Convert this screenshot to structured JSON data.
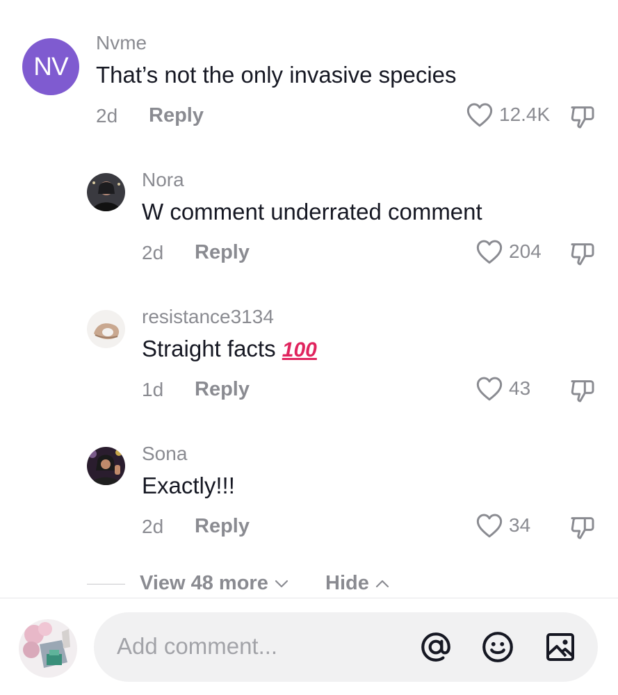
{
  "comments": [
    {
      "avatar_initials": "NV",
      "username": "Nvme",
      "text": "That’s not the only invasive species",
      "age": "2d",
      "reply_label": "Reply",
      "likes": "12.4K"
    },
    {
      "username": "Nora",
      "text": "W comment underrated comment",
      "age": "2d",
      "reply_label": "Reply",
      "likes": "204"
    },
    {
      "username": "resistance3134",
      "text": "Straight facts",
      "emoji": "100",
      "age": "1d",
      "reply_label": "Reply",
      "likes": "43"
    },
    {
      "username": "Sona",
      "text": "Exactly!!!",
      "age": "2d",
      "reply_label": "Reply",
      "likes": "34"
    }
  ],
  "thread_controls": {
    "view_more": "View 48 more",
    "hide": "Hide"
  },
  "composer": {
    "placeholder": "Add comment..."
  },
  "icons": [
    "heart-icon",
    "thumbs-down-icon",
    "chevron-down-icon",
    "chevron-up-icon",
    "at-mention-icon",
    "emoji-icon",
    "image-icon"
  ],
  "colors": {
    "avatar_purple": "#7f5bd0",
    "muted_text": "#8a8b91",
    "text": "#161823",
    "input_bg": "#f1f1f2"
  }
}
